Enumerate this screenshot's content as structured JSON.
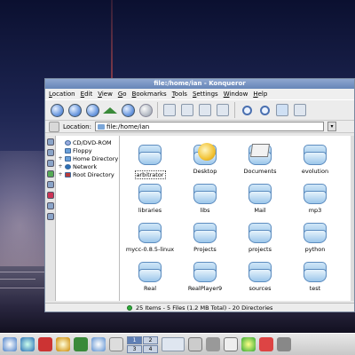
{
  "window": {
    "title": "file:/home/ian - Konqueror"
  },
  "menu": [
    {
      "u": "L",
      "rest": "ocation"
    },
    {
      "u": "E",
      "rest": "dit"
    },
    {
      "u": "V",
      "rest": "iew"
    },
    {
      "u": "G",
      "rest": "o"
    },
    {
      "u": "B",
      "rest": "ookmarks"
    },
    {
      "u": "T",
      "rest": "ools"
    },
    {
      "u": "S",
      "rest": "ettings"
    },
    {
      "u": "W",
      "rest": "indow"
    },
    {
      "u": "H",
      "rest": "elp"
    }
  ],
  "location": {
    "label": "Location:",
    "value": "file:/home/ian"
  },
  "tree": [
    {
      "label": "CD/DVD-ROM",
      "expander": "",
      "icon": "cdrom-icon"
    },
    {
      "label": "Floppy",
      "expander": "",
      "icon": "floppy-icon"
    },
    {
      "label": "Home Directory",
      "expander": "+",
      "icon": "home-folder-icon"
    },
    {
      "label": "Network",
      "expander": "+",
      "icon": "network-icon"
    },
    {
      "label": "Root Directory",
      "expander": "+",
      "icon": "root-folder-icon"
    }
  ],
  "files": [
    {
      "name": "arbitrator",
      "icon": "folder-icon",
      "focused": true
    },
    {
      "name": "Desktop",
      "icon": "desktop-folder-icon"
    },
    {
      "name": "Documents",
      "icon": "documents-folder-icon"
    },
    {
      "name": "evolution",
      "icon": "folder-icon"
    },
    {
      "name": "libraries",
      "icon": "folder-icon"
    },
    {
      "name": "libs",
      "icon": "folder-icon"
    },
    {
      "name": "Mail",
      "icon": "folder-icon"
    },
    {
      "name": "mp3",
      "icon": "folder-icon"
    },
    {
      "name": "mycc-0.8.5-linux",
      "icon": "folder-icon"
    },
    {
      "name": "Projects",
      "icon": "folder-icon"
    },
    {
      "name": "projects",
      "icon": "folder-icon"
    },
    {
      "name": "python",
      "icon": "folder-icon"
    },
    {
      "name": "Real",
      "icon": "folder-icon"
    },
    {
      "name": "RealPlayer9",
      "icon": "folder-icon"
    },
    {
      "name": "sources",
      "icon": "folder-icon"
    },
    {
      "name": "test",
      "icon": "folder-icon"
    }
  ],
  "status": {
    "text": "25 Items - 5 Files (1.2 MB Total) - 20 Directories"
  },
  "pager": [
    "1",
    "2",
    "3",
    "4"
  ],
  "taskbar_icons": [
    "kde-menu-icon",
    "network-icon",
    "toolbox-icon",
    "music-icon",
    "home-icon",
    "konqueror-icon",
    "mail-icon"
  ],
  "tray_icons": [
    "printer-icon",
    "mixer-icon",
    "klipper-icon",
    "star-icon",
    "flag-icon",
    "clock-icon",
    "speaker-icon"
  ]
}
